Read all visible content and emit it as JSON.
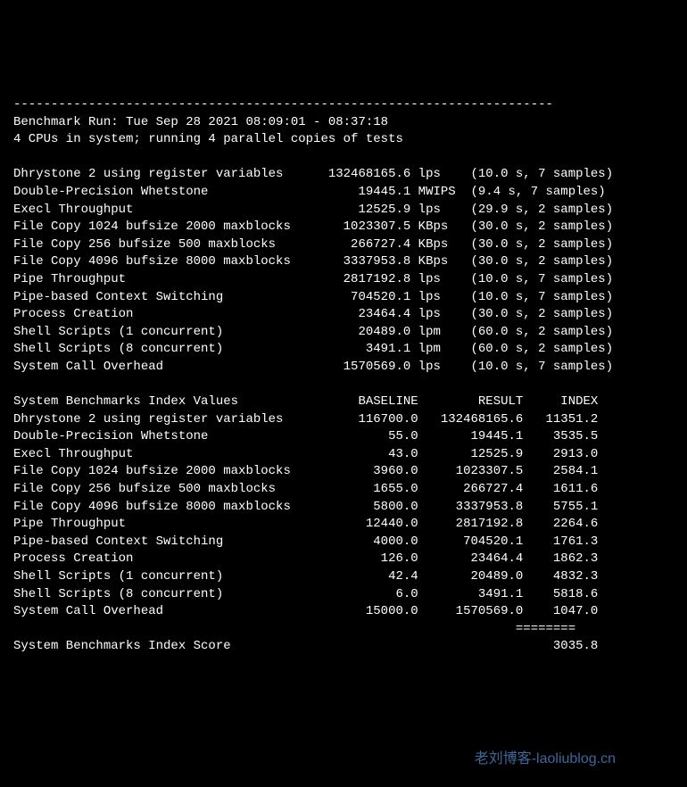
{
  "divider": "------------------------------------------------------------------------",
  "header": {
    "run_line": "Benchmark Run: Tue Sep 28 2021 08:09:01 - 08:37:18",
    "cpu_line": "4 CPUs in system; running 4 parallel copies of tests"
  },
  "results": [
    {
      "name": "Dhrystone 2 using register variables",
      "value": "132468165.6",
      "unit": "lps",
      "timing": "(10.0 s, 7 samples)"
    },
    {
      "name": "Double-Precision Whetstone",
      "value": "19445.1",
      "unit": "MWIPS",
      "timing": "(9.4 s, 7 samples)"
    },
    {
      "name": "Execl Throughput",
      "value": "12525.9",
      "unit": "lps",
      "timing": "(29.9 s, 2 samples)"
    },
    {
      "name": "File Copy 1024 bufsize 2000 maxblocks",
      "value": "1023307.5",
      "unit": "KBps",
      "timing": "(30.0 s, 2 samples)"
    },
    {
      "name": "File Copy 256 bufsize 500 maxblocks",
      "value": "266727.4",
      "unit": "KBps",
      "timing": "(30.0 s, 2 samples)"
    },
    {
      "name": "File Copy 4096 bufsize 8000 maxblocks",
      "value": "3337953.8",
      "unit": "KBps",
      "timing": "(30.0 s, 2 samples)"
    },
    {
      "name": "Pipe Throughput",
      "value": "2817192.8",
      "unit": "lps",
      "timing": "(10.0 s, 7 samples)"
    },
    {
      "name": "Pipe-based Context Switching",
      "value": "704520.1",
      "unit": "lps",
      "timing": "(10.0 s, 7 samples)"
    },
    {
      "name": "Process Creation",
      "value": "23464.4",
      "unit": "lps",
      "timing": "(30.0 s, 2 samples)"
    },
    {
      "name": "Shell Scripts (1 concurrent)",
      "value": "20489.0",
      "unit": "lpm",
      "timing": "(60.0 s, 2 samples)"
    },
    {
      "name": "Shell Scripts (8 concurrent)",
      "value": "3491.1",
      "unit": "lpm",
      "timing": "(60.0 s, 2 samples)"
    },
    {
      "name": "System Call Overhead",
      "value": "1570569.0",
      "unit": "lps",
      "timing": "(10.0 s, 7 samples)"
    }
  ],
  "index_header": {
    "label": "System Benchmarks Index Values",
    "baseline": "BASELINE",
    "result": "RESULT",
    "index": "INDEX"
  },
  "index": [
    {
      "name": "Dhrystone 2 using register variables",
      "baseline": "116700.0",
      "result": "132468165.6",
      "index": "11351.2"
    },
    {
      "name": "Double-Precision Whetstone",
      "baseline": "55.0",
      "result": "19445.1",
      "index": "3535.5"
    },
    {
      "name": "Execl Throughput",
      "baseline": "43.0",
      "result": "12525.9",
      "index": "2913.0"
    },
    {
      "name": "File Copy 1024 bufsize 2000 maxblocks",
      "baseline": "3960.0",
      "result": "1023307.5",
      "index": "2584.1"
    },
    {
      "name": "File Copy 256 bufsize 500 maxblocks",
      "baseline": "1655.0",
      "result": "266727.4",
      "index": "1611.6"
    },
    {
      "name": "File Copy 4096 bufsize 8000 maxblocks",
      "baseline": "5800.0",
      "result": "3337953.8",
      "index": "5755.1"
    },
    {
      "name": "Pipe Throughput",
      "baseline": "12440.0",
      "result": "2817192.8",
      "index": "2264.6"
    },
    {
      "name": "Pipe-based Context Switching",
      "baseline": "4000.0",
      "result": "704520.1",
      "index": "1761.3"
    },
    {
      "name": "Process Creation",
      "baseline": "126.0",
      "result": "23464.4",
      "index": "1862.3"
    },
    {
      "name": "Shell Scripts (1 concurrent)",
      "baseline": "42.4",
      "result": "20489.0",
      "index": "4832.3"
    },
    {
      "name": "Shell Scripts (8 concurrent)",
      "baseline": "6.0",
      "result": "3491.1",
      "index": "5818.6"
    },
    {
      "name": "System Call Overhead",
      "baseline": "15000.0",
      "result": "1570569.0",
      "index": "1047.0"
    }
  ],
  "score_divider": "                                                                   ========",
  "score": {
    "label": "System Benchmarks Index Score",
    "value": "3035.8"
  },
  "watermark": "老刘博客-laoliublog.cn"
}
